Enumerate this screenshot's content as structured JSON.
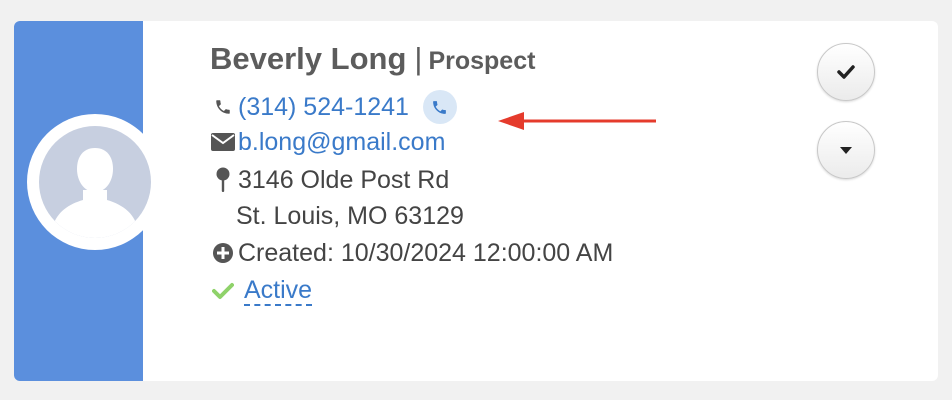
{
  "contact": {
    "name": "Beverly Long",
    "separator": "|",
    "type": "Prospect",
    "phone": "(314) 524-1241",
    "email": "b.long@gmail.com",
    "address_line1": "3146 Olde Post Rd",
    "address_line2": "St. Louis, MO 63129",
    "created_label": "Created: 10/30/2024 12:00:00 AM",
    "status": "Active"
  },
  "icons": {
    "phone": "phone-icon",
    "call": "call-icon",
    "email": "envelope-icon",
    "address": "map-pin-icon",
    "created": "plus-circle-icon",
    "status": "checkmark-icon",
    "complete": "checkmark-icon",
    "menu": "caret-down-icon"
  },
  "colors": {
    "band": "#5b8fdd",
    "link": "#3a7ac9",
    "status_check": "#8fd26a",
    "annotation_arrow": "#e53b2c"
  }
}
